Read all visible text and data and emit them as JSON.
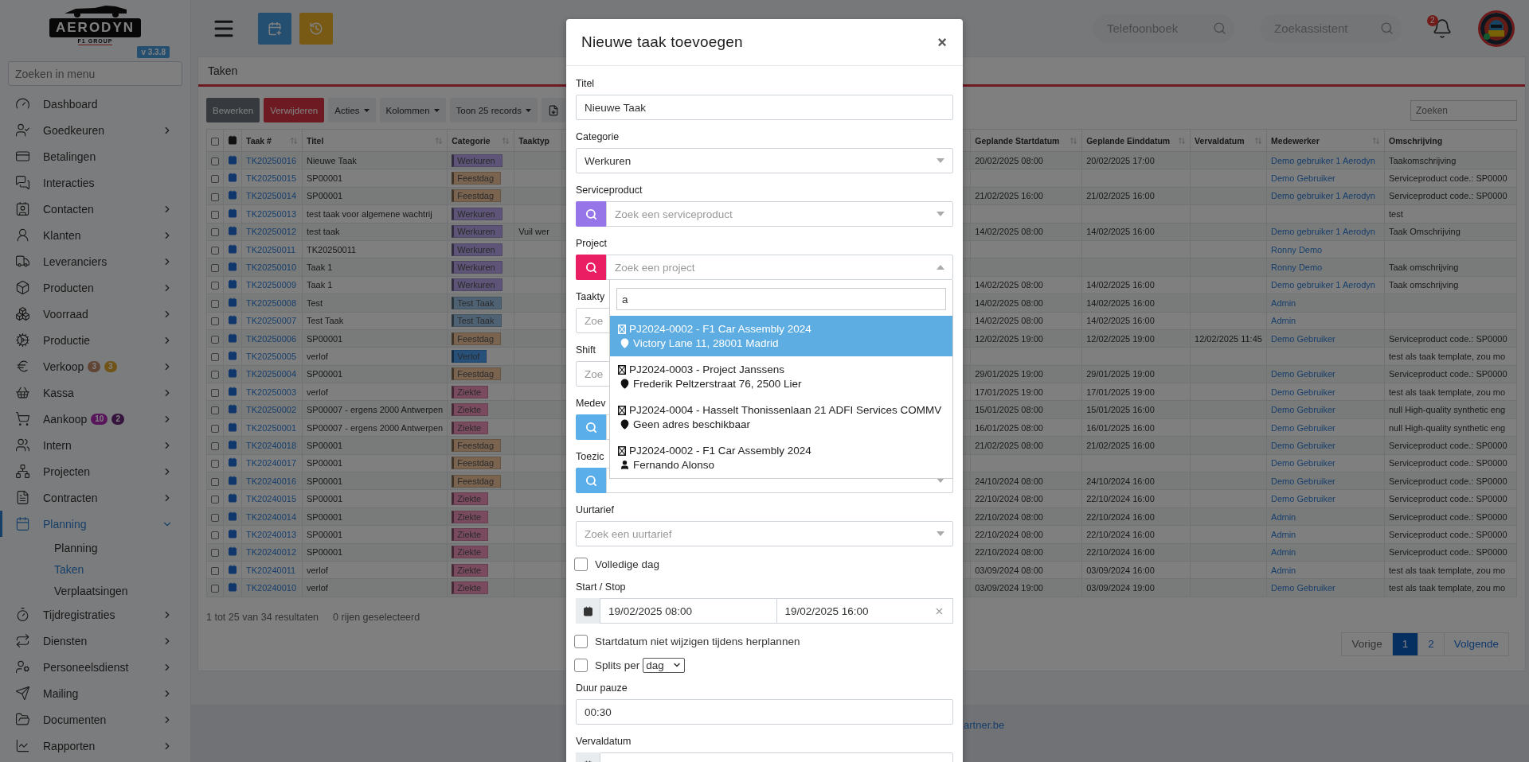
{
  "sidebar": {
    "logo": {
      "name": "AERODYN",
      "tagline": "F1 GROUP"
    },
    "version": "v 3.3.8",
    "search": {
      "placeholder": "Zoeken in menu"
    },
    "items": [
      {
        "label": "Dashboard",
        "selected": false
      },
      {
        "label": "Goedkeuren",
        "selected": false,
        "expanded": false
      },
      {
        "label": "Betalingen",
        "selected": false
      },
      {
        "label": "Interacties",
        "selected": false
      },
      {
        "label": "Contacten",
        "selected": false,
        "expanded": false
      },
      {
        "label": "Klanten",
        "selected": false,
        "expanded": false
      },
      {
        "label": "Leveranciers",
        "selected": false,
        "expanded": false
      },
      {
        "label": "Producten",
        "selected": false,
        "expanded": false
      },
      {
        "label": "Voorraad",
        "selected": false,
        "expanded": false
      },
      {
        "label": "Productie",
        "selected": false,
        "expanded": false
      },
      {
        "label": "Verkoop",
        "selected": false,
        "expanded": false,
        "badges": [
          {
            "text": "3",
            "color": "#604535"
          },
          {
            "text": "3",
            "color": "#705417"
          }
        ]
      },
      {
        "label": "Kassa",
        "selected": false,
        "expanded": false
      },
      {
        "label": "Aankoop",
        "selected": false,
        "expanded": false,
        "badges": [
          {
            "text": "10",
            "color": "#58155c"
          },
          {
            "text": "2",
            "color": "#35153d"
          }
        ]
      },
      {
        "label": "Intern",
        "selected": false,
        "expanded": false
      },
      {
        "label": "Projecten",
        "selected": false,
        "expanded": false
      },
      {
        "label": "Contracten",
        "selected": false,
        "expanded": false
      },
      {
        "label": "Planning",
        "selected": true,
        "expanded": true,
        "children": [
          {
            "label": "Planning",
            "selected": false
          },
          {
            "label": "Taken",
            "selected": true
          },
          {
            "label": "Verplaatsingen",
            "selected": false
          }
        ]
      },
      {
        "label": "Tijdregistraties",
        "selected": false,
        "expanded": false
      },
      {
        "label": "Diensten",
        "selected": false,
        "expanded": false
      },
      {
        "label": "Personeelsdienst",
        "selected": false,
        "expanded": false
      },
      {
        "label": "Mailing",
        "selected": false,
        "expanded": false
      },
      {
        "label": "Documenten",
        "selected": false,
        "expanded": false
      },
      {
        "label": "Rapporten",
        "selected": false,
        "expanded": false
      }
    ]
  },
  "topbar": {
    "phonebook": {
      "placeholder": "Telefoonboek"
    },
    "assistant": {
      "placeholder": "Zoekassistent"
    },
    "notifications": "2"
  },
  "card": {
    "title": "Taken",
    "toolbar": [
      {
        "kind": "secondary",
        "label": "Bewerken"
      },
      {
        "kind": "danger",
        "label": "Verwijderen"
      },
      {
        "kind": "dropdown",
        "label": "Acties"
      },
      {
        "kind": "dropdown",
        "label": "Kolommen"
      },
      {
        "kind": "dropdown",
        "label": "Toon 25 records"
      },
      {
        "kind": "icon"
      }
    ],
    "search": {
      "placeholder": "Zoeken"
    },
    "columns": [
      {
        "kind": "checkbox",
        "checked": false
      },
      {
        "kind": "icon"
      },
      {
        "label": "Taak #",
        "sortable": true
      },
      {
        "label": "Titel",
        "sortable": true
      },
      {
        "label": "Categorie",
        "sortable": true
      },
      {
        "label": "Taaktyp",
        "sortable": false
      },
      {
        "label": "Geplande Startdatum",
        "sortable": true
      },
      {
        "label": "Geplande Einddatum",
        "sortable": true
      },
      {
        "label": "Vervaldatum",
        "sortable": true
      },
      {
        "label": "Medewerker",
        "sortable": true
      },
      {
        "label": "Omschrijving",
        "sortable": false
      }
    ],
    "rows": [
      {
        "checked": false,
        "id": "TK20250016",
        "title": "Nieuwe Taak",
        "category": {
          "label": "Werkuren",
          "color": "#5d5477"
        },
        "start": "20/02/2025 08:00",
        "end": "20/02/2025 17:00",
        "employee": "Demo gebruiker 1 Aerodyn",
        "description": "Taakomschrijving"
      },
      {
        "checked": false,
        "id": "TK20250015",
        "title": "SP00001",
        "category": {
          "label": "Feestdag",
          "color": "#7a6450"
        },
        "employee": "Demo Gebruiker",
        "description": "Serviceproduct code.: SP0000"
      },
      {
        "checked": false,
        "id": "TK20250014",
        "title": "SP00001",
        "category": {
          "label": "Feestdag",
          "color": "#7a6450"
        },
        "start": "21/02/2025 16:00",
        "end": "21/02/2025 16:00",
        "employee": "Demo gebruiker 1 Aerodyn",
        "description": "Serviceproduct code.: SP0000"
      },
      {
        "checked": false,
        "id": "TK20250013",
        "title": "test taak voor algemene wachtrij",
        "category": {
          "label": "Werkuren",
          "color": "#5d5477"
        },
        "description": "test"
      },
      {
        "checked": false,
        "id": "TK20250012",
        "title": "test taak",
        "category": {
          "label": "Werkuren",
          "color": "#5d5477"
        },
        "type": "Vuil wer",
        "start": "14/02/2025 08:00",
        "end": "14/02/2025 16:00",
        "employee": "Demo gebruiker 1 Aerodyn",
        "description": "Taak Omschrijving"
      },
      {
        "checked": false,
        "id": "TK20250011",
        "title": "TK20250011",
        "category": {
          "label": "Werkuren",
          "color": "#5d5477"
        },
        "employee": "Ronny Demo"
      },
      {
        "checked": false,
        "id": "TK20250010",
        "title": "Taak 1",
        "category": {
          "label": "Werkuren",
          "color": "#5d5477"
        },
        "employee": "Ronny Demo",
        "description": "Taak omschrijving"
      },
      {
        "checked": false,
        "id": "TK20250009",
        "title": "Taak 1",
        "category": {
          "label": "Werkuren",
          "color": "#5d5477"
        },
        "start": "14/02/2025 08:00",
        "end": "14/02/2025 16:00",
        "employee": "Demo gebruiker 1 Aerodyn",
        "description": "Taak omschrijving"
      },
      {
        "checked": false,
        "id": "TK20250008",
        "title": "Test",
        "category": {
          "label": "Test Taak",
          "color": "#4e6273"
        },
        "start": "14/02/2025 08:00",
        "end": "14/02/2025 16:00",
        "employee": "Admin"
      },
      {
        "checked": false,
        "id": "TK20250007",
        "title": "Test Taak",
        "category": {
          "label": "Test Taak",
          "color": "#4e6273"
        },
        "start": "14/02/2025 08:00",
        "end": "14/02/2025 16:00",
        "employee": "Admin"
      },
      {
        "checked": false,
        "id": "TK20250006",
        "title": "SP00001",
        "category": {
          "label": "Feestdag",
          "color": "#7a6450"
        },
        "start": "12/02/2025 19:00",
        "end": "12/02/2025 19:00",
        "due": "12/02/2025 11:45",
        "employee": "Demo Gebruiker",
        "description": "Serviceproduct code.: SP0000"
      },
      {
        "checked": false,
        "id": "TK20250005",
        "title": "verlof",
        "category": {
          "label": "Verlof",
          "color": "#27517a"
        },
        "description": "test als taak template, zou mo"
      },
      {
        "checked": false,
        "id": "TK20250004",
        "title": "SP00001",
        "category": {
          "label": "Feestdag",
          "color": "#7a6450"
        },
        "start": "29/01/2025 19:00",
        "end": "29/01/2025 19:00",
        "employee": "Demo Gebruiker",
        "description": "Serviceproduct code.: SP0000"
      },
      {
        "checked": false,
        "id": "TK20250003",
        "title": "verlof",
        "category": {
          "label": "Ziekte",
          "color": "#7a4b5f"
        },
        "start": "17/01/2025 19:00",
        "end": "17/01/2025 19:00",
        "employee": "Demo Gebruiker",
        "description": "test als taak template, zou mo"
      },
      {
        "checked": false,
        "id": "TK20250002",
        "title": "SP00007 - ergens 2000 Antwerpen",
        "category": {
          "label": "Ziekte",
          "color": "#7a4b5f"
        },
        "start": "15/01/2025 08:00",
        "end": "15/01/2025 16:00",
        "employee": "Demo Gebruiker",
        "description": "null High-quality synthetic eng"
      },
      {
        "checked": false,
        "id": "TK20250001",
        "title": "SP00007 - ergens 2000 Antwerpen",
        "category": {
          "label": "Ziekte",
          "color": "#7a4b5f"
        },
        "start": "16/01/2025 08:00",
        "end": "16/01/2025 16:00",
        "employee": "Demo Gebruiker",
        "description": "null High-quality synthetic eng"
      },
      {
        "checked": false,
        "id": "TK20240018",
        "title": "SP00001",
        "category": {
          "label": "Feestdag",
          "color": "#7a6450"
        },
        "start": "21/02/2025 08:00",
        "end": "21/02/2025 16:00",
        "employee": "Demo Gebruiker",
        "description": "Serviceproduct code.: SP0000"
      },
      {
        "checked": false,
        "id": "TK20240017",
        "title": "SP00001",
        "category": {
          "label": "Feestdag",
          "color": "#7a6450"
        },
        "employee": "Demo Gebruiker",
        "description": "Serviceproduct code.: SP0000"
      },
      {
        "checked": false,
        "id": "TK20240016",
        "title": "SP00001",
        "category": {
          "label": "Feestdag",
          "color": "#7a6450"
        },
        "start": "24/10/2024 08:00",
        "end": "24/10/2024 16:00",
        "employee": "Demo Gebruiker",
        "description": "Serviceproduct code.: SP0000"
      },
      {
        "checked": false,
        "id": "TK20240015",
        "title": "SP00001",
        "category": {
          "label": "Ziekte",
          "color": "#7a4b5f"
        },
        "start": "22/10/2024 08:00",
        "end": "22/10/2024 16:00",
        "employee": "Demo Gebruiker",
        "description": "Serviceproduct code.: SP0000"
      },
      {
        "checked": false,
        "id": "TK20240014",
        "title": "SP00001",
        "category": {
          "label": "Ziekte",
          "color": "#7a4b5f"
        },
        "start": "22/10/2024 08:00",
        "end": "22/10/2024 16:00",
        "employee": "Admin",
        "description": "Serviceproduct code.: SP0000"
      },
      {
        "checked": false,
        "id": "TK20240013",
        "title": "SP00001",
        "category": {
          "label": "Ziekte",
          "color": "#7a4b5f"
        },
        "start": "22/10/2024 08:00",
        "end": "22/10/2024 16:00",
        "employee": "Admin",
        "description": "Serviceproduct code.: SP0000"
      },
      {
        "checked": false,
        "id": "TK20240012",
        "title": "SP00001",
        "category": {
          "label": "Ziekte",
          "color": "#7a4b5f"
        },
        "start": "22/10/2024 08:00",
        "end": "22/10/2024 16:00",
        "employee": "Admin",
        "description": "Serviceproduct code.: SP0000"
      },
      {
        "checked": false,
        "id": "TK20240011",
        "title": "verlof",
        "category": {
          "label": "Ziekte",
          "color": "#7a4b5f"
        },
        "start": "03/09/2024 08:00",
        "end": "03/09/2024 16:00",
        "employee": "Admin",
        "description": "test als taak template, zou mo"
      },
      {
        "checked": false,
        "id": "TK20240010",
        "title": "verlof",
        "category": {
          "label": "Ziekte",
          "color": "#7a4b5f"
        },
        "start": "03/09/2024 19:00",
        "end": "03/09/2024 19:00",
        "employee": "Demo Gebruiker",
        "description": "test als taak template, zou mo"
      }
    ],
    "summary": {
      "results": "1 tot 25 van 34 resultaten",
      "selection": "0 rijen geselecteerd"
    },
    "pagination": [
      {
        "label": "Vorige",
        "selected": false,
        "disabled": true
      },
      {
        "label": "1",
        "selected": true,
        "disabled": false
      },
      {
        "label": "2",
        "selected": false,
        "disabled": false
      },
      {
        "label": "Volgende",
        "selected": false,
        "disabled": false
      }
    ]
  },
  "footer": {
    "text": "artner.be"
  },
  "modal": {
    "title": "Nieuwe taak toevoegen",
    "close": "×",
    "fields": [
      {
        "kind": "text",
        "label": "Titel",
        "value": "Nieuwe Taak"
      },
      {
        "kind": "select",
        "label": "Categorie",
        "value": "Werkuren"
      },
      {
        "kind": "search_select",
        "label": "Serviceproduct",
        "placeholder": "Zoek een serviceproduct",
        "color": "#9575e8"
      },
      {
        "kind": "search_select",
        "label": "Project",
        "placeholder": "Zoek een project",
        "color": "#e91e63",
        "dropdown": {
          "query": "a",
          "options": [
            {
              "kind": "address",
              "title": "PJ2024-0002 - F1 Car Assembly 2024",
              "detail": "Victory Lane 11, 28001 Madrid",
              "selected": true
            },
            {
              "kind": "address",
              "title": "PJ2024-0003 - Project Janssens",
              "detail": "Frederik Peltzerstraat 76, 2500 Lier",
              "selected": false
            },
            {
              "kind": "address",
              "title": "PJ2024-0004 - Hasselt Thonissenlaan 21 ADFI Services COMMV",
              "detail": "Geen adres beschikbaar",
              "selected": false
            },
            {
              "kind": "person",
              "title": "PJ2024-0002 - F1 Car Assembly 2024",
              "detail": "Fernando Alonso",
              "selected": false
            }
          ]
        }
      },
      {
        "kind": "select",
        "label": "Taakty",
        "placeholder": "Zoe"
      },
      {
        "kind": "select",
        "label": "Shift",
        "placeholder": "Zoe"
      },
      {
        "kind": "search_select",
        "label": "Medev",
        "color": "#5aaeea"
      },
      {
        "kind": "search_select",
        "label": "Toezic",
        "color": "#5aaeea"
      },
      {
        "kind": "select",
        "label": "Uurtarief",
        "placeholder": "Zoek een uurtarief"
      },
      {
        "kind": "checkbox",
        "label": "Volledige dag",
        "checked": false
      },
      {
        "kind": "daterange",
        "label": "Start / Stop",
        "start": "19/02/2025 08:00",
        "end": "19/02/2025 16:00"
      },
      {
        "kind": "checkbox",
        "label": "Startdatum niet wijzigen tijdens herplannen",
        "checked": false
      },
      {
        "kind": "checkbox_select",
        "label": "Splits per",
        "checked": false,
        "value": "dag"
      },
      {
        "kind": "text",
        "label": "Duur pauze",
        "value": "00:30"
      },
      {
        "kind": "date",
        "label": "Vervaldatum"
      }
    ]
  }
}
